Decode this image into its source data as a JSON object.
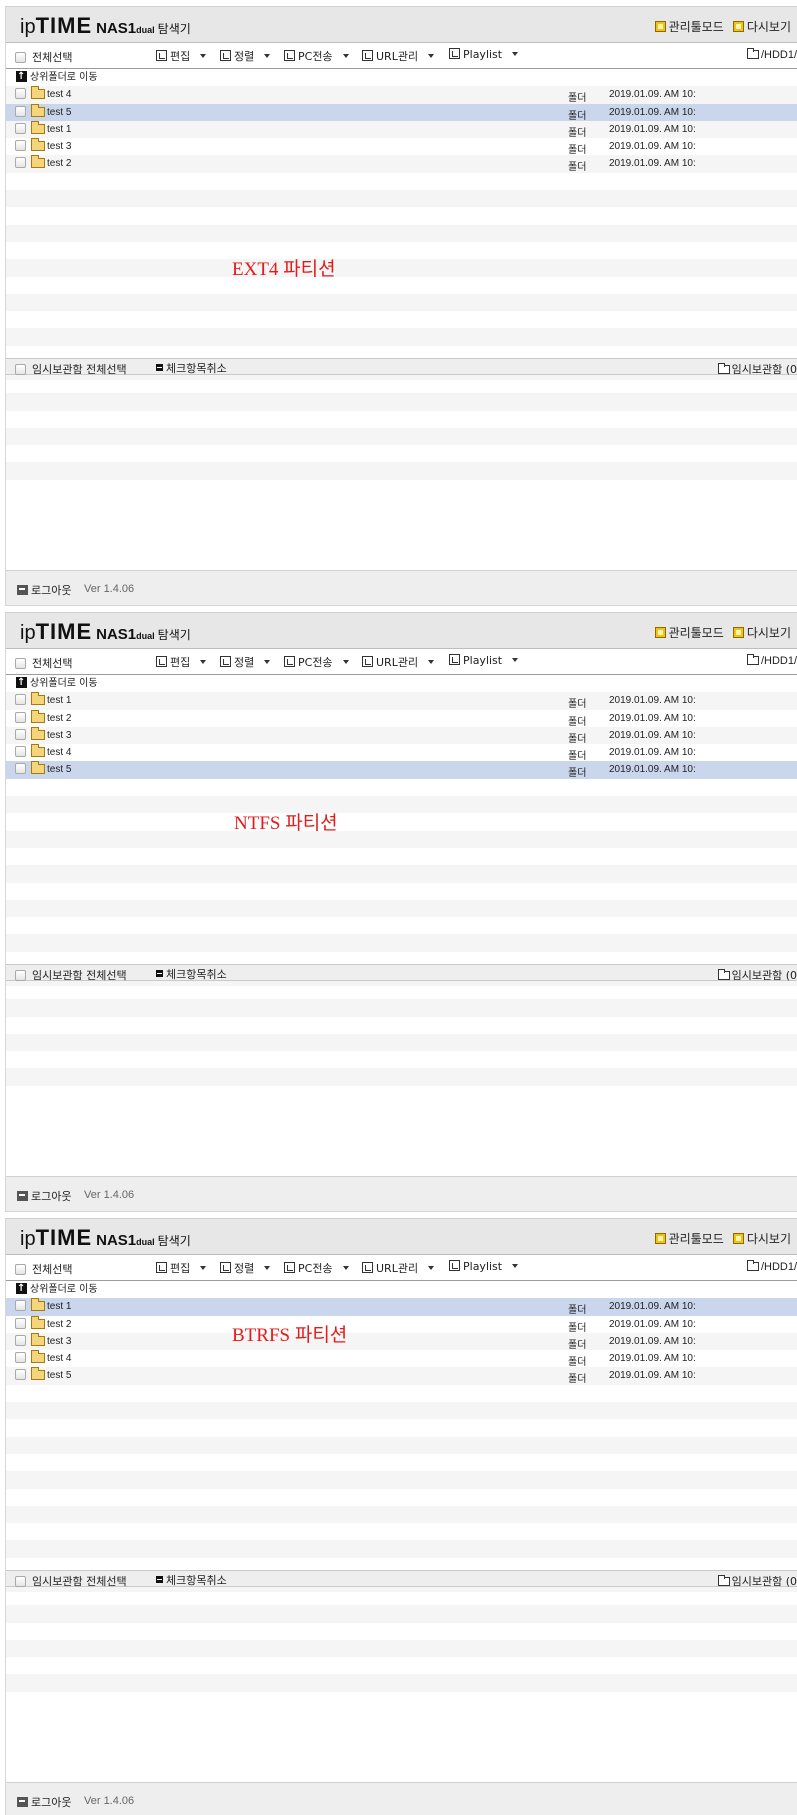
{
  "app": {
    "logo_ip": "ip",
    "logo_time": "TIME",
    "logo_model": "NAS1",
    "logo_dual": "dual",
    "logo_app": "탐색기",
    "admin_mode": "관리툴모드",
    "refresh": "다시보기"
  },
  "toolbar": {
    "select_all": "전체선택",
    "edit": "편집",
    "sort": "정렬",
    "pc_transfer": "PC전송",
    "url_manage": "URL관리",
    "playlist": "Playlist",
    "path": "/HDD1/"
  },
  "up_folder": "상위폴더로 이동",
  "temp_bar": {
    "select_all": "임시보관함 전체선택",
    "uncheck": "체크항목취소",
    "temp_box": "임시보관함 (0"
  },
  "footer": {
    "logout": "로그아웃",
    "version": "Ver 1.4.06"
  },
  "panels": [
    {
      "label": "EXT4 파티션",
      "files": [
        {
          "name": "test 4",
          "type": "폴더",
          "date": "2019.01.09. AM 10:",
          "selected": false
        },
        {
          "name": "test 5",
          "type": "폴더",
          "date": "2019.01.09. AM 10:",
          "selected": true
        },
        {
          "name": "test 1",
          "type": "폴더",
          "date": "2019.01.09. AM 10:",
          "selected": false
        },
        {
          "name": "test 3",
          "type": "폴더",
          "date": "2019.01.09. AM 10:",
          "selected": false
        },
        {
          "name": "test 2",
          "type": "폴더",
          "date": "2019.01.09. AM 10:",
          "selected": false
        }
      ]
    },
    {
      "label": "NTFS 파티션",
      "files": [
        {
          "name": "test 1",
          "type": "폴더",
          "date": "2019.01.09. AM 10:",
          "selected": false
        },
        {
          "name": "test 2",
          "type": "폴더",
          "date": "2019.01.09. AM 10:",
          "selected": false
        },
        {
          "name": "test 3",
          "type": "폴더",
          "date": "2019.01.09. AM 10:",
          "selected": false
        },
        {
          "name": "test 4",
          "type": "폴더",
          "date": "2019.01.09. AM 10:",
          "selected": false
        },
        {
          "name": "test 5",
          "type": "폴더",
          "date": "2019.01.09. AM 10:",
          "selected": true
        }
      ]
    },
    {
      "label": "BTRFS 파티션",
      "files": [
        {
          "name": "test 1",
          "type": "폴더",
          "date": "2019.01.09. AM 10:",
          "selected": true
        },
        {
          "name": "test 2",
          "type": "폴더",
          "date": "2019.01.09. AM 10:",
          "selected": false
        },
        {
          "name": "test 3",
          "type": "폴더",
          "date": "2019.01.09. AM 10:",
          "selected": false
        },
        {
          "name": "test 4",
          "type": "폴더",
          "date": "2019.01.09. AM 10:",
          "selected": false
        },
        {
          "name": "test 5",
          "type": "폴더",
          "date": "2019.01.09. AM 10:",
          "selected": false
        }
      ]
    }
  ]
}
